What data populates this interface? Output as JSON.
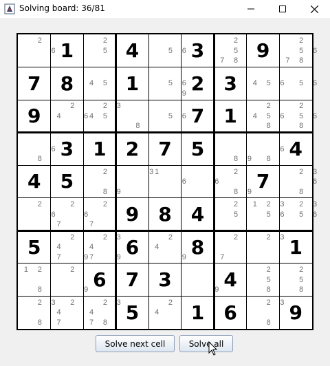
{
  "window": {
    "title": "Solving board: 36/81",
    "icon": "java-app-icon",
    "controls": [
      "minimize-icon",
      "maximize-icon",
      "close-icon"
    ]
  },
  "board": {
    "rows": [
      [
        {
          "c": [
            2,
            6
          ]
        },
        {
          "v": 1
        },
        {
          "c": [
            2,
            5
          ]
        },
        {
          "v": 4
        },
        {
          "c": [
            5,
            6
          ]
        },
        {
          "v": 3
        },
        {
          "c": [
            2,
            5,
            7,
            8
          ]
        },
        {
          "v": 9
        },
        {
          "c": [
            2,
            5,
            6,
            7,
            8
          ]
        }
      ],
      [
        {
          "v": 7
        },
        {
          "v": 8
        },
        {
          "c": [
            4,
            5
          ]
        },
        {
          "v": 1
        },
        {
          "c": [
            5,
            6,
            9
          ]
        },
        {
          "v": 2
        },
        {
          "v": 3
        },
        {
          "c": [
            4,
            5,
            6
          ]
        },
        {
          "c": [
            5,
            6
          ]
        }
      ],
      [
        {
          "v": 9
        },
        {
          "c": [
            2,
            4,
            6
          ]
        },
        {
          "c": [
            2,
            3,
            4,
            5
          ]
        },
        {
          "c": [
            8
          ]
        },
        {
          "c": [
            5,
            6
          ]
        },
        {
          "v": 7
        },
        {
          "v": 1
        },
        {
          "c": [
            2,
            4,
            5,
            6,
            8
          ]
        },
        {
          "c": [
            2,
            5,
            6,
            8
          ]
        }
      ],
      [
        {
          "c": [
            6,
            8
          ]
        },
        {
          "v": 3
        },
        {
          "v": 1
        },
        {
          "v": 2
        },
        {
          "v": 7
        },
        {
          "v": 5
        },
        {
          "c": [
            8,
            9
          ]
        },
        {
          "c": [
            6,
            8
          ]
        },
        {
          "v": 4
        }
      ],
      [
        {
          "v": 4
        },
        {
          "v": 5
        },
        {
          "c": [
            2,
            8,
            9
          ]
        },
        {
          "c": [
            3
          ]
        },
        {
          "c": [
            1,
            6
          ]
        },
        {
          "c": [
            6
          ]
        },
        {
          "c": [
            2,
            8,
            9
          ]
        },
        {
          "v": 7
        },
        {
          "c": [
            2,
            3,
            6,
            8
          ]
        }
      ],
      [
        {
          "c": [
            2,
            6
          ]
        },
        {
          "c": [
            2,
            6,
            7
          ]
        },
        {
          "c": [
            2,
            7
          ]
        },
        {
          "v": 9
        },
        {
          "v": 8
        },
        {
          "v": 4
        },
        {
          "c": [
            2,
            5
          ]
        },
        {
          "c": [
            1,
            2,
            3,
            5,
            6
          ]
        },
        {
          "c": [
            2,
            3,
            5,
            6
          ]
        }
      ],
      [
        {
          "v": 5
        },
        {
          "c": [
            2,
            4,
            7,
            9
          ]
        },
        {
          "c": [
            2,
            3,
            4,
            7,
            9
          ]
        },
        {
          "v": 6
        },
        {
          "c": [
            2,
            4,
            9
          ]
        },
        {
          "v": 8
        },
        {
          "c": [
            2,
            7
          ]
        },
        {
          "c": [
            2,
            3
          ]
        },
        {
          "v": 1
        }
      ],
      [
        {
          "c": [
            1,
            2,
            8
          ]
        },
        {
          "c": [
            2,
            9
          ]
        },
        {
          "v": 6
        },
        {
          "v": 7
        },
        {
          "v": 3
        },
        {
          "c": [
            9
          ]
        },
        {
          "v": 4
        },
        {
          "c": [
            2,
            5,
            8
          ]
        },
        {
          "c": [
            2,
            5,
            8
          ]
        }
      ],
      [
        {
          "c": [
            2,
            3,
            8
          ]
        },
        {
          "c": [
            2,
            4,
            7
          ]
        },
        {
          "c": [
            2,
            3,
            4,
            7,
            8
          ]
        },
        {
          "v": 5
        },
        {
          "c": [
            2,
            4
          ]
        },
        {
          "v": 1
        },
        {
          "v": 6
        },
        {
          "c": [
            2,
            3,
            8
          ]
        },
        {
          "v": 9
        }
      ]
    ]
  },
  "buttons": {
    "solve_next": "Solve next cell",
    "solve_all": "Solve all"
  },
  "colors": {
    "given": "#000000",
    "candidate": "#707070",
    "button_border": "#8c9eb8"
  }
}
